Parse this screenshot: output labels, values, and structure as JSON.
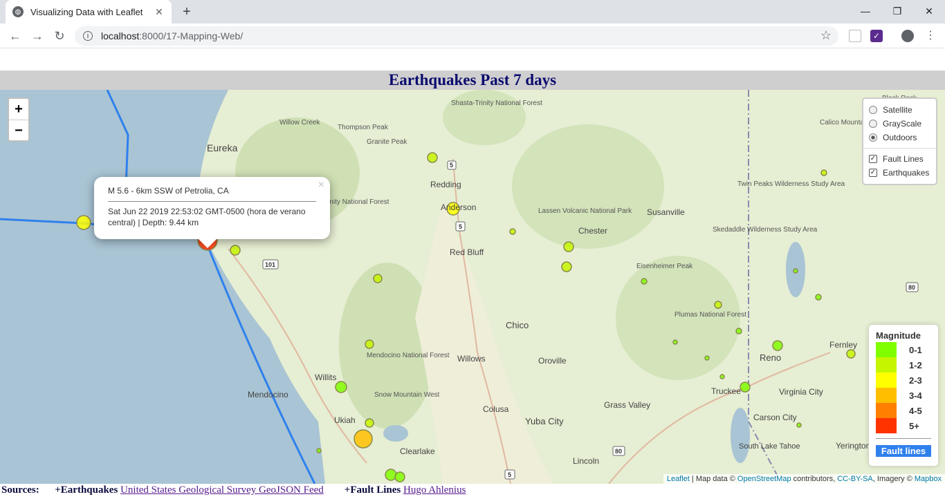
{
  "browser": {
    "tab_title": "Visualizing Data with Leaflet",
    "url_host": "localhost",
    "url_path": ":8000/17-Mapping-Web/"
  },
  "page": {
    "title": "Earthquakes Past 7 days"
  },
  "map": {
    "zoom_in": "+",
    "zoom_out": "−",
    "base_layers": [
      {
        "label": "Satellite",
        "selected": false
      },
      {
        "label": "GrayScale",
        "selected": false
      },
      {
        "label": "Outdoors",
        "selected": true
      }
    ],
    "overlays": [
      {
        "label": "Fault Lines",
        "checked": true
      },
      {
        "label": "Earthquakes",
        "checked": true
      }
    ],
    "popup": {
      "title": "M 5.6 - 6km SSW of Petrolia, CA",
      "detail": "Sat Jun 22 2019 22:53:02 GMT-0500 (hora de verano central) | Depth: 9.44 km"
    },
    "places": [
      "Eureka",
      "Redding",
      "Anderson",
      "Red Bluff",
      "Chico",
      "Willows",
      "Oroville",
      "Yuba City",
      "Colusa",
      "Willits",
      "Ukiah",
      "Mendocino",
      "Clearlake",
      "Reno",
      "Truckee",
      "Carson City",
      "Susanville",
      "Chester",
      "Fernley",
      "Lincoln",
      "Grass Valley",
      "Virginia City",
      "Yerington",
      "South Lake Tahoe",
      "Thompson Peak",
      "Granite Peak",
      "Willow Creek",
      "Shasta-Trinity National Forest",
      "Lassen Volcanic National Park",
      "Eisenheimer Peak",
      "Plumas National Forest",
      "Mendocino National Forest",
      "Snow Mountain West",
      "Skedaddle Wilderness Study Area",
      "Twin Peaks Wilderness Study Area",
      "Calico Mountains Wilderness Area",
      "Black Rock",
      "Trinity National Forest"
    ],
    "highway_shields": [
      "5",
      "5",
      "101",
      "80",
      "80",
      "5"
    ],
    "attribution": {
      "leaflet": "Leaflet",
      "map_data": " | Map data © ",
      "osm": "OpenStreetMap",
      "contributors": " contributors, ",
      "license": "CC-BY-SA",
      "imagery": ", Imagery © ",
      "mapbox": "Mapbox"
    }
  },
  "legend": {
    "title": "Magnitude",
    "items": [
      {
        "label": "0-1",
        "color": "#80ff00"
      },
      {
        "label": "1-2",
        "color": "#c6f500"
      },
      {
        "label": "2-3",
        "color": "#ffff00"
      },
      {
        "label": "3-4",
        "color": "#ffbf00"
      },
      {
        "label": "4-5",
        "color": "#ff7f00"
      },
      {
        "label": "5+",
        "color": "#ff3300"
      }
    ],
    "fault_label": "Fault lines",
    "fault_color": "#2f80ed"
  },
  "sources": {
    "label": "Sources:",
    "eq_label": "+Earthquakes",
    "eq_link": "United States Geological Survey GeoJSON Feed",
    "fault_label": "+Fault Lines",
    "fault_link": "Hugo Ahlenius"
  }
}
